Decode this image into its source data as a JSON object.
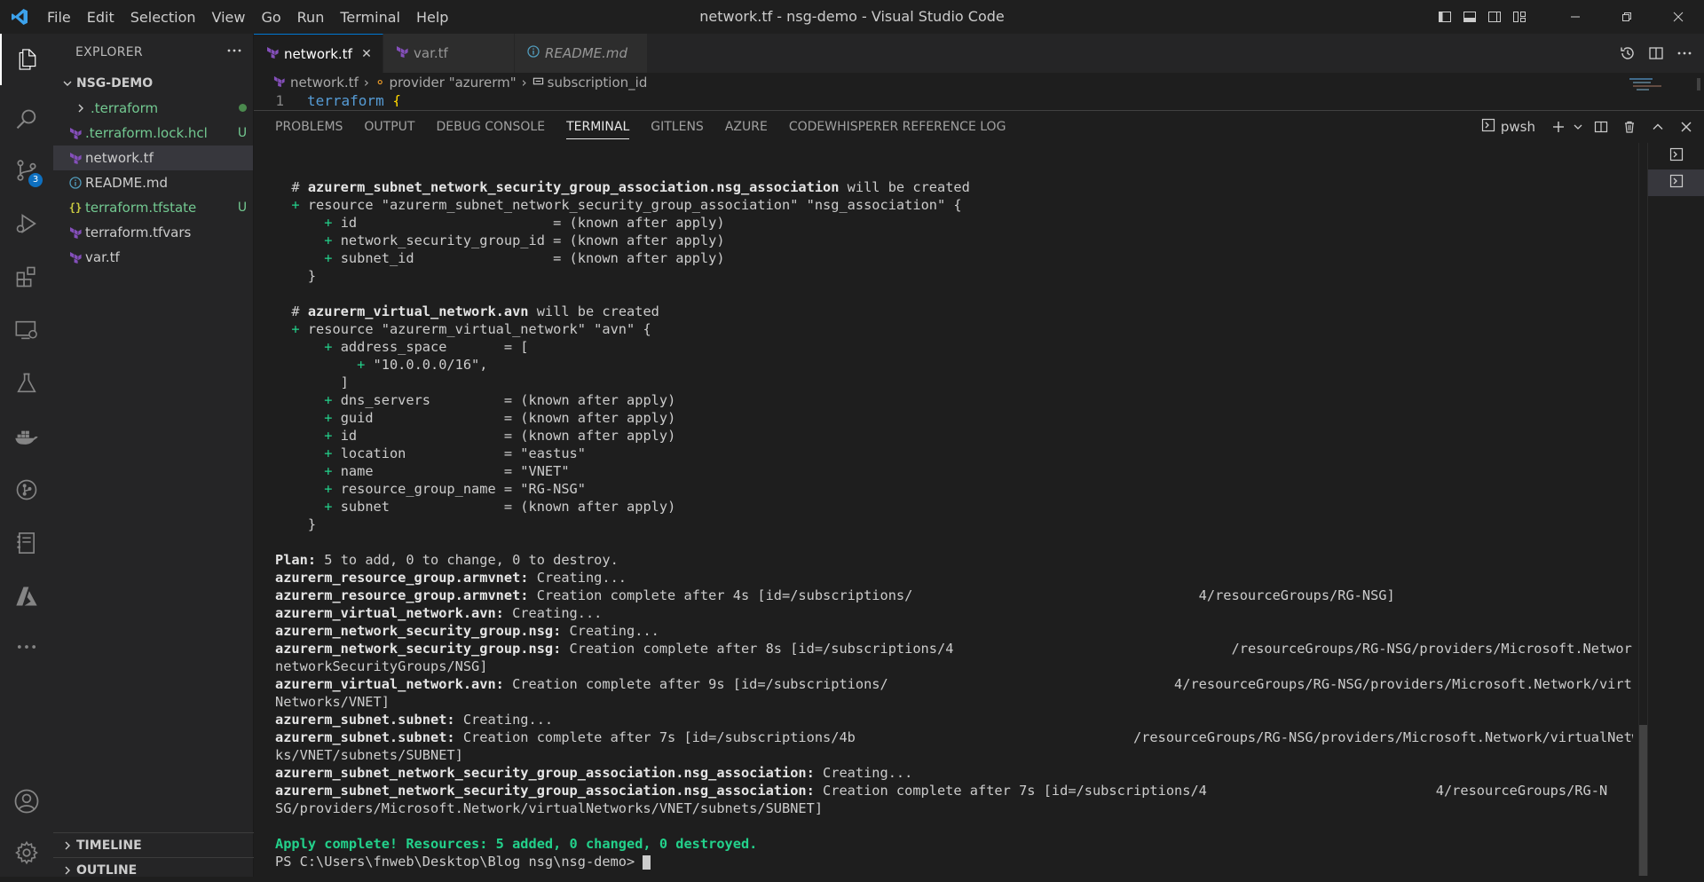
{
  "window": {
    "title": "network.tf - nsg-demo - Visual Studio Code",
    "menu": [
      "File",
      "Edit",
      "Selection",
      "View",
      "Go",
      "Run",
      "Terminal",
      "Help"
    ]
  },
  "activity_bar": {
    "items": [
      {
        "name": "explorer",
        "icon": "files-icon"
      },
      {
        "name": "search",
        "icon": "search-icon"
      },
      {
        "name": "source-control",
        "icon": "source-control-icon",
        "badge": "3"
      },
      {
        "name": "run-debug",
        "icon": "run-debug-icon"
      },
      {
        "name": "extensions",
        "icon": "extensions-icon"
      },
      {
        "name": "remote-explorer",
        "icon": "remote-explorer-icon"
      },
      {
        "name": "testing",
        "icon": "flask-icon"
      },
      {
        "name": "docker",
        "icon": "docker-icon"
      },
      {
        "name": "gitlens",
        "icon": "gitlens-icon"
      },
      {
        "name": "notebook",
        "icon": "notebook-icon"
      },
      {
        "name": "azure",
        "icon": "azure-icon"
      },
      {
        "name": "more",
        "icon": "more-icon"
      }
    ],
    "bottom": [
      {
        "name": "accounts",
        "icon": "account-icon"
      },
      {
        "name": "manage",
        "icon": "gear-icon"
      }
    ]
  },
  "explorer": {
    "header": "EXPLORER",
    "folder": "NSG-DEMO",
    "files": [
      {
        "name": ".terraform",
        "kind": "folder",
        "status": "dot",
        "color": "#73c991"
      },
      {
        "name": ".terraform.lock.hcl",
        "kind": "terraform",
        "status": "U",
        "color": "#73c991"
      },
      {
        "name": "network.tf",
        "kind": "terraform",
        "status": "",
        "color": "#cccccc",
        "selected": true
      },
      {
        "name": "README.md",
        "kind": "info",
        "status": "",
        "color": "#cccccc"
      },
      {
        "name": "terraform.tfstate",
        "kind": "json",
        "status": "U",
        "color": "#73c991"
      },
      {
        "name": "terraform.tfvars",
        "kind": "terraform",
        "status": "",
        "color": "#cccccc"
      },
      {
        "name": "var.tf",
        "kind": "terraform",
        "status": "",
        "color": "#cccccc"
      }
    ],
    "timeline": "TIMELINE",
    "outline": "OUTLINE"
  },
  "tabs": [
    {
      "label": "network.tf",
      "active": true
    },
    {
      "label": "var.tf",
      "active": false
    },
    {
      "label": "README.md",
      "active": false
    }
  ],
  "breadcrumb": {
    "file": "network.tf",
    "provider": "provider \"azurerm\"",
    "symbol": "subscription_id"
  },
  "code_peek": {
    "line": "1",
    "text": "terraform",
    "brace": "{"
  },
  "panel": {
    "tabs": [
      "PROBLEMS",
      "OUTPUT",
      "DEBUG CONSOLE",
      "TERMINAL",
      "GITLENS",
      "AZURE",
      "CODEWHISPERER REFERENCE LOG"
    ],
    "active_tab": "TERMINAL",
    "shell": "pwsh"
  },
  "terminal": {
    "lines": [
      "",
      "",
      "  # azurerm_subnet_network_security_group_association.nsg_association will be created",
      "  + resource \"azurerm_subnet_network_security_group_association\" \"nsg_association\" {",
      "      + id                        = (known after apply)",
      "      + network_security_group_id = (known after apply)",
      "      + subnet_id                 = (known after apply)",
      "    }",
      "",
      "  # azurerm_virtual_network.avn will be created",
      "  + resource \"azurerm_virtual_network\" \"avn\" {",
      "      + address_space       = [",
      "          + \"10.0.0.0/16\",",
      "        ]",
      "      + dns_servers         = (known after apply)",
      "      + guid                = (known after apply)",
      "      + id                  = (known after apply)",
      "      + location            = \"eastus\"",
      "      + name                = \"VNET\"",
      "      + resource_group_name = \"RG-NSG\"",
      "      + subnet              = (known after apply)",
      "    }",
      "",
      "Plan: 5 to add, 0 to change, 0 to destroy.",
      "azurerm_resource_group.armvnet: Creating...",
      "azurerm_resource_group.armvnet: Creation complete after 4s [id=/subscriptions/                                   4/resourceGroups/RG-NSG]",
      "azurerm_virtual_network.avn: Creating...",
      "azurerm_network_security_group.nsg: Creating...",
      "azurerm_network_security_group.nsg: Creation complete after 8s [id=/subscriptions/4                                  /resourceGroups/RG-NSG/providers/Microsoft.Network/",
      "networkSecurityGroups/NSG]",
      "azurerm_virtual_network.avn: Creation complete after 9s [id=/subscriptions/                                   4/resourceGroups/RG-NSG/providers/Microsoft.Network/virtual",
      "Networks/VNET]",
      "azurerm_subnet.subnet: Creating...",
      "azurerm_subnet.subnet: Creation complete after 7s [id=/subscriptions/4b                                  /resourceGroups/RG-NSG/providers/Microsoft.Network/virtualNetwor",
      "ks/VNET/subnets/SUBNET]",
      "azurerm_subnet_network_security_group_association.nsg_association: Creating...",
      "azurerm_subnet_network_security_group_association.nsg_association: Creation complete after 7s [id=/subscriptions/4                            4/resourceGroups/RG-N",
      "SG/providers/Microsoft.Network/virtualNetworks/VNET/subnets/SUBNET]",
      "",
      "Apply complete! Resources: 5 added, 0 changed, 0 destroyed.",
      "PS C:\\Users\\fnweb\\Desktop\\Blog nsg\\nsg-demo> "
    ]
  },
  "colors": {
    "accent": "#0078d4",
    "git_untracked": "#73c991",
    "terraform_purple": "#844fba",
    "terminal_green": "#23d18b"
  }
}
